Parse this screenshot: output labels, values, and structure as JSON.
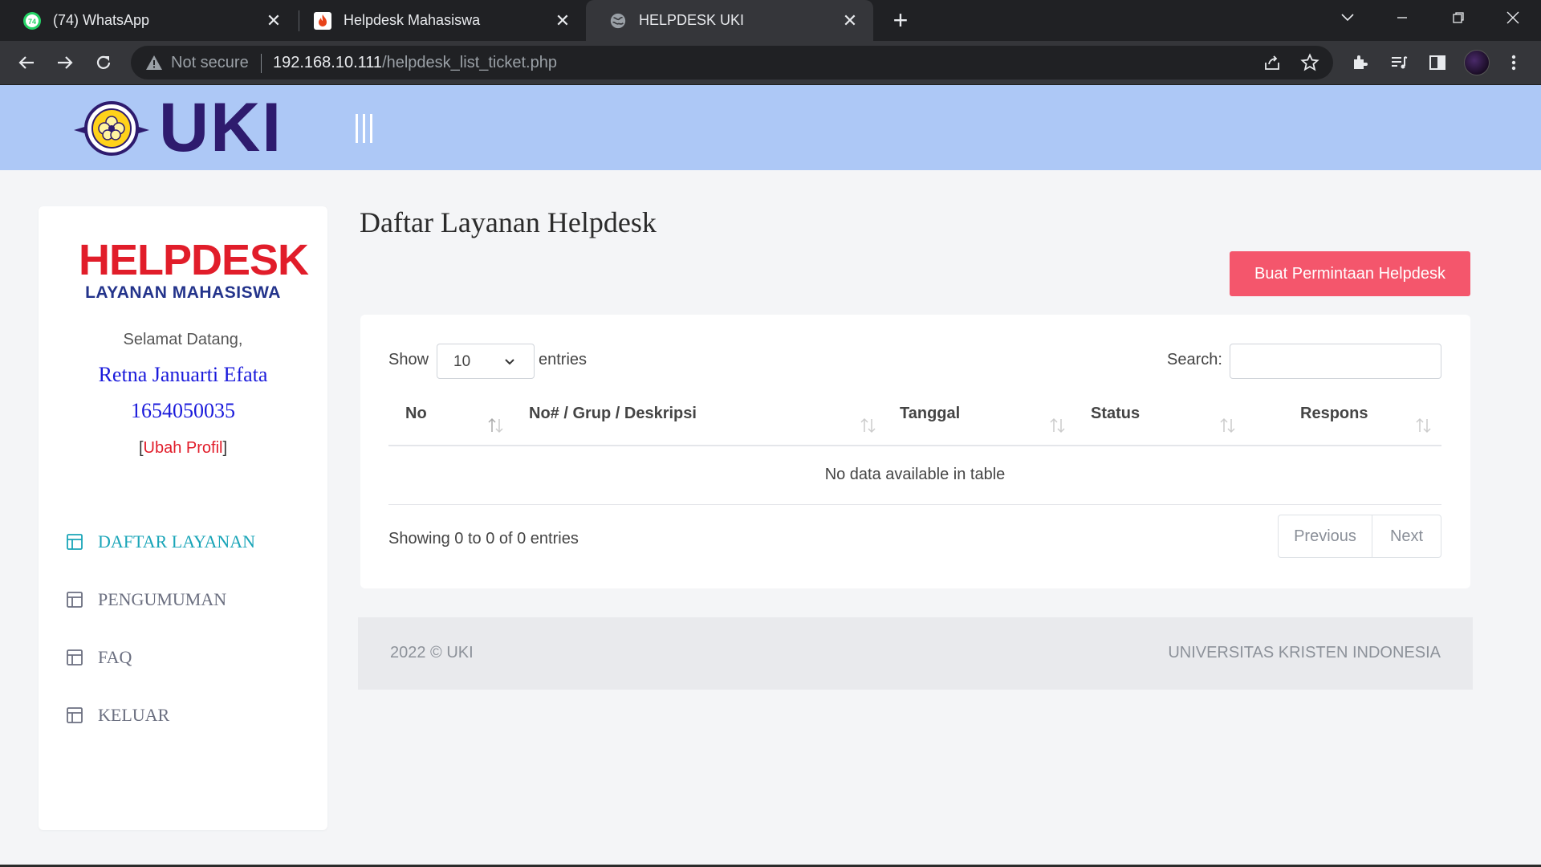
{
  "browser": {
    "tabs": [
      {
        "title": "(74) WhatsApp",
        "icon": "whatsapp-icon",
        "badge": "74"
      },
      {
        "title": "Helpdesk Mahasiswa",
        "icon": "flame-icon"
      },
      {
        "title": "HELPDESK UKI",
        "icon": "globe-icon",
        "active": true
      }
    ],
    "security_label": "Not secure",
    "url_host": "192.168.10.111",
    "url_path": "/helpdesk_list_ticket.php"
  },
  "header": {
    "logo_text": "UKI"
  },
  "sidebar": {
    "brand_big": "HELPDESK",
    "brand_small": "LAYANAN MAHASISWA",
    "welcome": "Selamat Datang,",
    "user_name": "Retna Januarti Efata",
    "user_id": "1654050035",
    "edit_open": "[",
    "edit_link": "Ubah Profil",
    "edit_close": "]",
    "menu": [
      {
        "label": "DAFTAR LAYANAN",
        "active": true
      },
      {
        "label": "PENGUMUMAN"
      },
      {
        "label": "FAQ"
      },
      {
        "label": "KELUAR"
      }
    ]
  },
  "main": {
    "title": "Daftar Layanan Helpdesk",
    "create_button": "Buat Permintaan Helpdesk",
    "table": {
      "show_label": "Show",
      "entries_value": "10",
      "entries_label": "entries",
      "search_label": "Search:",
      "search_value": "",
      "columns": [
        "No",
        "No# / Grup / Deskripsi",
        "Tanggal",
        "Status",
        "Respons"
      ],
      "empty_message": "No data available in table",
      "info": "Showing 0 to 0 of 0 entries",
      "prev_label": "Previous",
      "next_label": "Next"
    }
  },
  "footer": {
    "left": "2022 © UKI",
    "right": "UNIVERSITAS KRISTEN INDONESIA"
  },
  "colors": {
    "header_bg": "#adc8f6",
    "accent_red": "#f4566c",
    "active_menu": "#1aa5b8",
    "user_blue": "#1a1adb"
  }
}
